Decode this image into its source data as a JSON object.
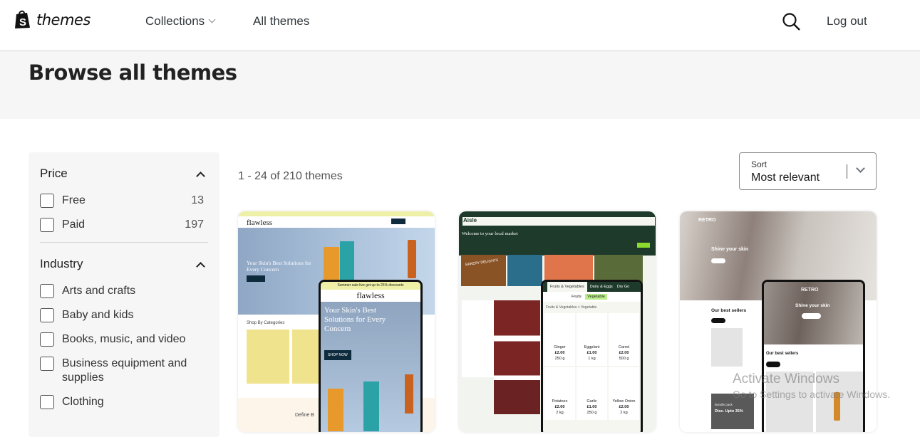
{
  "header": {
    "logo_text": "themes",
    "nav": [
      {
        "label": "Collections"
      },
      {
        "label": "All themes"
      }
    ],
    "logout": "Log out"
  },
  "page_title": "Browse all themes",
  "filters": {
    "price": {
      "title": "Price",
      "options": [
        {
          "label": "Free",
          "count": "13"
        },
        {
          "label": "Paid",
          "count": "197"
        }
      ]
    },
    "industry": {
      "title": "Industry",
      "options": [
        {
          "label": "Arts and crafts"
        },
        {
          "label": "Baby and kids"
        },
        {
          "label": "Books, music, and video"
        },
        {
          "label": "Business equipment and supplies"
        },
        {
          "label": "Clothing"
        }
      ]
    }
  },
  "results": {
    "count_text": "1 - 24 of 210 themes"
  },
  "sort": {
    "label": "Sort",
    "value": "Most relevant"
  },
  "themes": [
    {
      "brand": "flawless",
      "headline": "Your Skin's Best Solutions for Every Concern",
      "cta": "SHOP NOW",
      "section": "Shop By Categories",
      "banner": "Summer sale live get up to 25% discounts",
      "footer_text": "Define B"
    },
    {
      "brand": "Aisle",
      "headline": "Welcome to your local market",
      "tile": "BAKERY DELIGHTS",
      "tabs": [
        "Fruits & Vegetables",
        "Dairy & Eggs",
        "Dry Go"
      ],
      "subtabs": [
        "Fruits",
        "Vegetable"
      ],
      "breadcrumb": "Fruits & Vegetables  >  Vegetable",
      "products": [
        {
          "name": "Ginger",
          "price": "£2.00",
          "qty": "250 g"
        },
        {
          "name": "Eggplant",
          "price": "£1.00",
          "qty": "1 kg"
        },
        {
          "name": "Carrot",
          "price": "£2.00",
          "qty": "500 g"
        },
        {
          "name": "Potatoes",
          "price": "£2.00",
          "qty": "2 kg"
        },
        {
          "name": "Garlic",
          "price": "£1.00",
          "qty": "250 g"
        },
        {
          "name": "Yellow Onion",
          "price": "£2.00",
          "qty": "2 kg"
        }
      ]
    },
    {
      "brand": "RETRO",
      "headline": "Shine your skin",
      "section": "Our best sellers",
      "promo_label": "Bundle pack",
      "promo": "Disc. Upto 35%"
    }
  ],
  "watermark": {
    "line1": "Activate Windows",
    "line2": "Go to Settings to activate Windows."
  },
  "colors": {
    "aisle_green": "#1e3a2a",
    "aisle_accent": "#8bdc2c",
    "flawless_yellow": "#eef0a8",
    "retro_brown": "#6b5a55"
  }
}
